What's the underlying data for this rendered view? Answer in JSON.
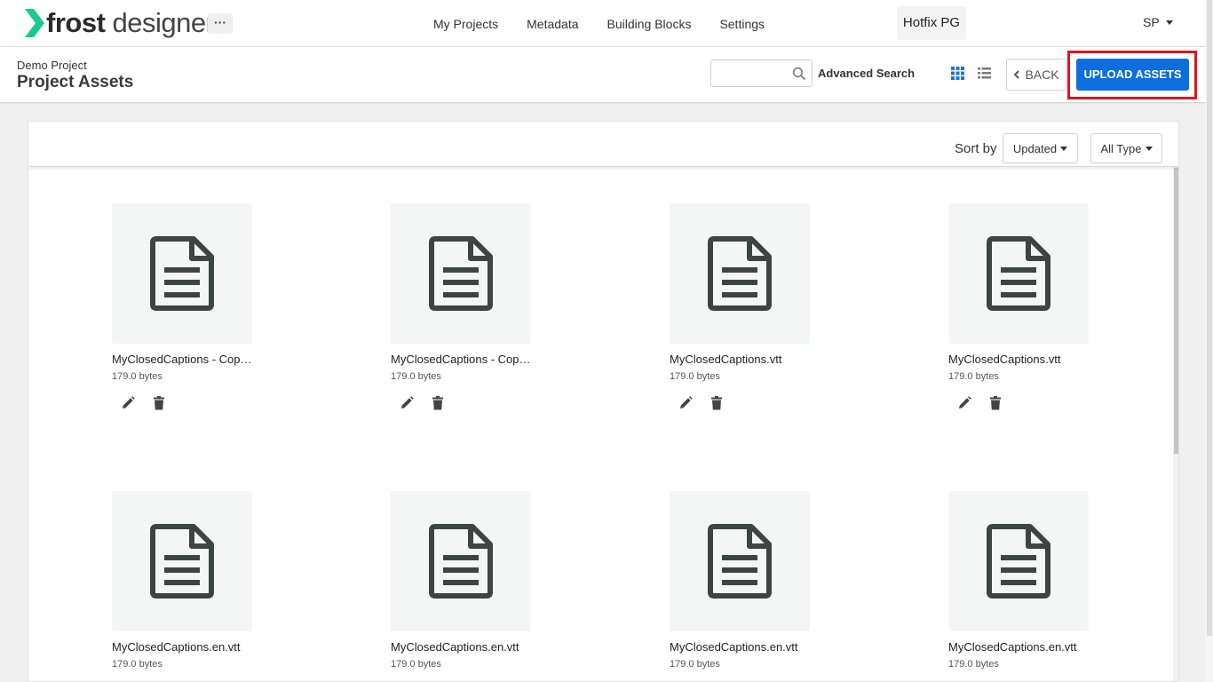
{
  "nav": {
    "logo_bold": "frost",
    "logo_regular": " designer",
    "more_label": "···",
    "links": [
      "My Projects",
      "Metadata",
      "Building Blocks",
      "Settings"
    ],
    "project_name": "Hotfix PG",
    "user_initials": "SP"
  },
  "header": {
    "breadcrumb": "Demo Project",
    "title": "Project Assets",
    "search_value": "",
    "search_placeholder": "",
    "advanced_search": "Advanced Search",
    "back_label": "BACK",
    "upload_label": "UPLOAD ASSETS"
  },
  "toolbar": {
    "sort_label": "Sort by",
    "sort_value": "Updated",
    "type_value": "All Type"
  },
  "assets": [
    {
      "name": "MyClosedCaptions - Copy...",
      "size": "179.0 bytes"
    },
    {
      "name": "MyClosedCaptions - Copy...",
      "size": "179.0 bytes"
    },
    {
      "name": "MyClosedCaptions.vtt",
      "size": "179.0 bytes"
    },
    {
      "name": "MyClosedCaptions.vtt",
      "size": "179.0 bytes"
    },
    {
      "name": "MyClosedCaptions.en.vtt",
      "size": "179.0 bytes"
    },
    {
      "name": "MyClosedCaptions.en.vtt",
      "size": "179.0 bytes"
    },
    {
      "name": "MyClosedCaptions.en.vtt",
      "size": "179.0 bytes"
    },
    {
      "name": "MyClosedCaptions.en.vtt",
      "size": "179.0 bytes"
    }
  ],
  "colors": {
    "accent": "#0d6fde",
    "highlight": "#e0141b",
    "logo_green": "#19c98f",
    "icon": "#3d4543"
  }
}
